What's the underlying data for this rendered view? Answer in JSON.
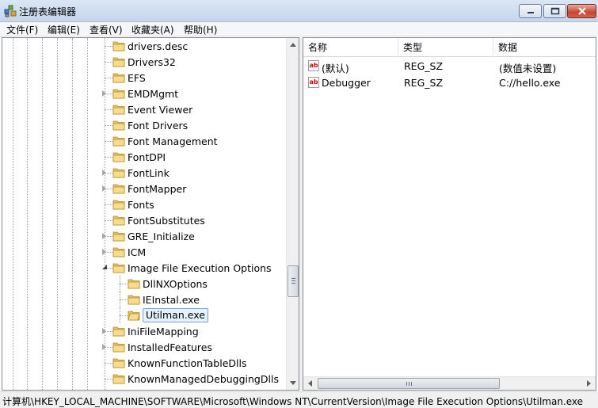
{
  "window": {
    "title": "注册表编辑器"
  },
  "menu": [
    "文件(F)",
    "编辑(E)",
    "查看(V)",
    "收藏夹(A)",
    "帮助(H)"
  ],
  "tree": {
    "items": [
      {
        "label": "drivers.desc",
        "level": 1,
        "expander": "none",
        "selected": false
      },
      {
        "label": "Drivers32",
        "level": 1,
        "expander": "none",
        "selected": false
      },
      {
        "label": "EFS",
        "level": 1,
        "expander": "none",
        "selected": false
      },
      {
        "label": "EMDMgmt",
        "level": 1,
        "expander": "closed",
        "selected": false
      },
      {
        "label": "Event Viewer",
        "level": 1,
        "expander": "none",
        "selected": false
      },
      {
        "label": "Font Drivers",
        "level": 1,
        "expander": "none",
        "selected": false
      },
      {
        "label": "Font Management",
        "level": 1,
        "expander": "none",
        "selected": false
      },
      {
        "label": "FontDPI",
        "level": 1,
        "expander": "none",
        "selected": false
      },
      {
        "label": "FontLink",
        "level": 1,
        "expander": "closed",
        "selected": false
      },
      {
        "label": "FontMapper",
        "level": 1,
        "expander": "closed",
        "selected": false
      },
      {
        "label": "Fonts",
        "level": 1,
        "expander": "none",
        "selected": false
      },
      {
        "label": "FontSubstitutes",
        "level": 1,
        "expander": "none",
        "selected": false
      },
      {
        "label": "GRE_Initialize",
        "level": 1,
        "expander": "closed",
        "selected": false
      },
      {
        "label": "ICM",
        "level": 1,
        "expander": "closed",
        "selected": false
      },
      {
        "label": "Image File Execution Options",
        "level": 1,
        "expander": "open",
        "selected": false
      },
      {
        "label": "DllNXOptions",
        "level": 2,
        "expander": "none",
        "selected": false
      },
      {
        "label": "IEInstal.exe",
        "level": 2,
        "expander": "none",
        "selected": false
      },
      {
        "label": "Utilman.exe",
        "level": 2,
        "expander": "none",
        "selected": true
      },
      {
        "label": "IniFileMapping",
        "level": 1,
        "expander": "closed",
        "selected": false
      },
      {
        "label": "InstalledFeatures",
        "level": 1,
        "expander": "closed",
        "selected": false
      },
      {
        "label": "KnownFunctionTableDlls",
        "level": 1,
        "expander": "none",
        "selected": false
      },
      {
        "label": "KnownManagedDebuggingDlls",
        "level": 1,
        "expander": "none",
        "selected": false
      }
    ]
  },
  "list": {
    "columns": [
      "名称",
      "类型",
      "数据"
    ],
    "rows": [
      {
        "name": "(默认)",
        "type": "REG_SZ",
        "data": "(数值未设置)",
        "icon": "string-value-icon"
      },
      {
        "name": "Debugger",
        "type": "REG_SZ",
        "data": "C://hello.exe",
        "icon": "string-value-icon"
      }
    ],
    "icon_text": "ab"
  },
  "status": {
    "path": "计算机\\HKEY_LOCAL_MACHINE\\SOFTWARE\\Microsoft\\Windows NT\\CurrentVersion\\Image File Execution Options\\Utilman.exe"
  },
  "colors": {
    "folder": "#e8c45a",
    "selection_bg": "#e5f1fb",
    "selection_border": "#7da2ce",
    "close_button": "#c74532"
  }
}
